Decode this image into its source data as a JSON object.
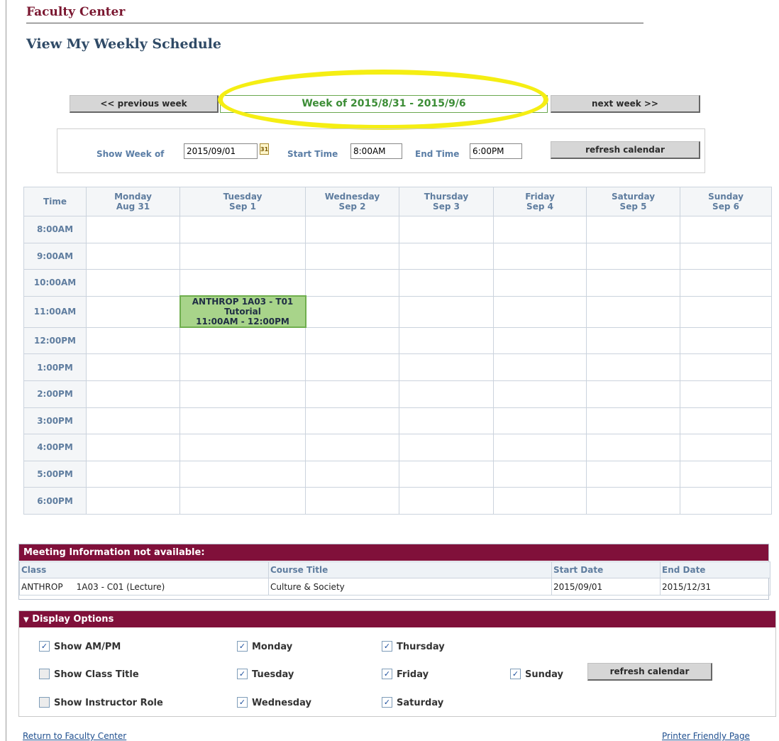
{
  "header": {
    "app_title": "Faculty Center",
    "page_title": "View My Weekly Schedule"
  },
  "week_nav": {
    "prev_label": "<< previous week",
    "week_label": "Week of 2015/8/31 - 2015/9/6",
    "next_label": "next week >>"
  },
  "filters": {
    "show_week_label": "Show Week of",
    "show_week_value": "2015/09/01",
    "start_time_label": "Start Time",
    "start_time_value": "8:00AM",
    "end_time_label": "End Time",
    "end_time_value": "6:00PM",
    "refresh_label": "refresh calendar",
    "calendar_icon_glyph": "31"
  },
  "schedule": {
    "time_header": "Time",
    "days": [
      {
        "name": "Monday",
        "date": "Aug 31"
      },
      {
        "name": "Tuesday",
        "date": "Sep 1"
      },
      {
        "name": "Wednesday",
        "date": "Sep 2"
      },
      {
        "name": "Thursday",
        "date": "Sep 3"
      },
      {
        "name": "Friday",
        "date": "Sep 4"
      },
      {
        "name": "Saturday",
        "date": "Sep 5"
      },
      {
        "name": "Sunday",
        "date": "Sep 6"
      }
    ],
    "times": [
      "8:00AM",
      "9:00AM",
      "10:00AM",
      "11:00AM",
      "12:00PM",
      "1:00PM",
      "2:00PM",
      "3:00PM",
      "4:00PM",
      "5:00PM",
      "6:00PM"
    ],
    "event": {
      "course": "ANTHROP 1A03 - T01",
      "type": "Tutorial",
      "time": "11:00AM - 12:00PM",
      "day_index": 1,
      "time_index": 3,
      "color": "#a8d48a"
    }
  },
  "meeting_info": {
    "title": "Meeting Information not available:",
    "headers": {
      "class": "Class",
      "course_title": "Course Title",
      "start_date": "Start Date",
      "end_date": "End Date"
    },
    "row": {
      "class_subject": "ANTHROP",
      "class_section": "1A03 - C01 (Lecture)",
      "course_title": "Culture & Society",
      "start_date": "2015/09/01",
      "end_date": "2015/12/31"
    }
  },
  "display_options": {
    "title": "Display Options",
    "items": [
      {
        "label": "Show AM/PM",
        "checked": true
      },
      {
        "label": "Show Class Title",
        "checked": false
      },
      {
        "label": "Show Instructor Role",
        "checked": false
      },
      {
        "label": "Monday",
        "checked": true
      },
      {
        "label": "Tuesday",
        "checked": true
      },
      {
        "label": "Wednesday",
        "checked": true
      },
      {
        "label": "Thursday",
        "checked": true
      },
      {
        "label": "Friday",
        "checked": true
      },
      {
        "label": "Saturday",
        "checked": true
      },
      {
        "label": "Sunday",
        "checked": true
      }
    ],
    "refresh_label": "refresh calendar"
  },
  "footer": {
    "return_link": "Return to Faculty Center",
    "printer_link": "Printer Friendly Page"
  },
  "colors": {
    "brand": "#80103a",
    "accent_green": "#3c8d36",
    "highlight": "#f5ee13",
    "label_blue": "#5f7d9f"
  }
}
